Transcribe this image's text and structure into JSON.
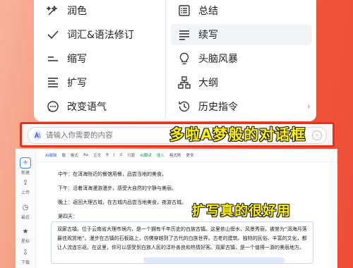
{
  "menu": {
    "left_items": [
      {
        "label": "润色",
        "icon": "sparkle-pen-icon"
      },
      {
        "label": "词汇&语法修订",
        "icon": "checkmark-icon"
      },
      {
        "label": "缩写",
        "icon": "shorten-lines-icon"
      },
      {
        "label": "扩写",
        "icon": "expand-lines-icon"
      },
      {
        "label": "改变语气",
        "icon": "chat-bubble-icon"
      }
    ],
    "right_items": [
      {
        "label": "总结",
        "icon": "list-box-icon"
      },
      {
        "label": "续写",
        "icon": "continue-lines-icon"
      },
      {
        "label": "头脑风暴",
        "icon": "lightbulb-icon"
      },
      {
        "label": "大纲",
        "icon": "outline-tree-icon"
      },
      {
        "label": "历史指令",
        "icon": "history-clock-icon",
        "chevron": "›"
      }
    ]
  },
  "search": {
    "placeholder": "请输入你需要的内容",
    "send_icon": "send-icon"
  },
  "overlays": {
    "top": "多啦A梦般的对话框",
    "bottom": "扩写真的很好用"
  },
  "sidebar": {
    "tools": [
      {
        "label": "新建",
        "glyph": "+"
      },
      {
        "label": "上传",
        "glyph": "⇪"
      },
      {
        "label": "最近",
        "glyph": "◷"
      },
      {
        "label": "星标",
        "glyph": "★"
      },
      {
        "label": "下载",
        "glyph": "⇩"
      }
    ]
  },
  "toolbar": {
    "items": [
      "AI编辑",
      "撤",
      "格式",
      "Aa",
      "正文",
      "B",
      "I",
      "U",
      "行距",
      "AI翻译",
      "插入",
      "格式刷",
      "更多"
    ]
  },
  "doc": {
    "lines": [
      "中午：在洱海附近的餐馆用餐，品尝当地的美食。",
      "下午：沿着洱海漫游漫步，感受大自然的宁静与美丽。",
      "晚上：返回大理古城，在古城内品尝当地美食，夜游古城。",
      "第四天："
    ],
    "paragraph": "双廊古镇。位于云南省大理市境内，是一个拥有千年历史的白族古镇。这里依山傍水，风景秀丽，被誉为“洱海月落最佳观赏地”。漫步在古镇的石板路上，仿佛穿越到了古代的白族世界。古老的建筑、独特的民俗、丰富的文化，都让人流连忘返。在这里，你可以感受到白族人民的淳朴善良和热情好客。双廊古镇，是一个值得一游的美丽地方。"
  },
  "colors": {
    "accent_red": "#e8301f",
    "overlay_yellow": "#fff200",
    "toolbar_green": "#1a9c5b"
  }
}
